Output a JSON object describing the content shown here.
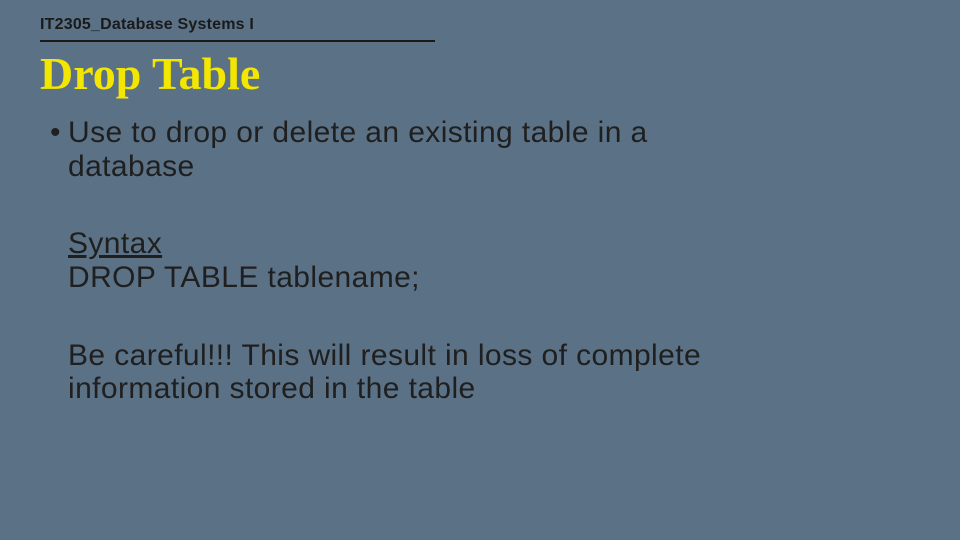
{
  "header": {
    "course": "IT2305_Database Systems I"
  },
  "title": "Drop Table",
  "content": {
    "bullet1": "Use to drop or delete an existing table in a database",
    "syntax_label": "Syntax",
    "syntax_code": "DROP TABLE tablename;",
    "warning": "Be careful!!! This will result in loss of complete information stored in the table"
  }
}
